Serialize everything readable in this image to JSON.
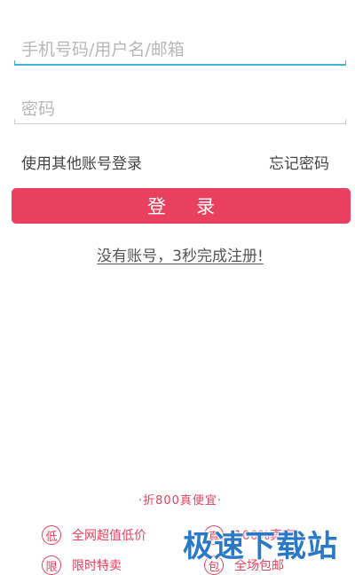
{
  "login_form": {
    "phone_placeholder": "手机号码/用户名/邮箱",
    "password_placeholder": "密码",
    "other_login_label": "使用其他账号登录",
    "forgot_password_label": "忘记密码",
    "login_button_label": "登录",
    "register_label": "没有账号，3秒完成注册!"
  },
  "promo": {
    "title": "·折800真便宜·",
    "items": [
      {
        "badge": "低",
        "label": "全网超值低价"
      },
      {
        "badge": "限",
        "label": "限时特卖"
      },
      {
        "badge": "真",
        "label": "100%真实"
      },
      {
        "badge": "包",
        "label": "全场包邮"
      }
    ]
  },
  "watermark": {
    "text": "极速下载站"
  },
  "colors": {
    "accent": "#e8405e",
    "focus_underline": "#3fb5d8",
    "watermark": "#2a78c8"
  }
}
